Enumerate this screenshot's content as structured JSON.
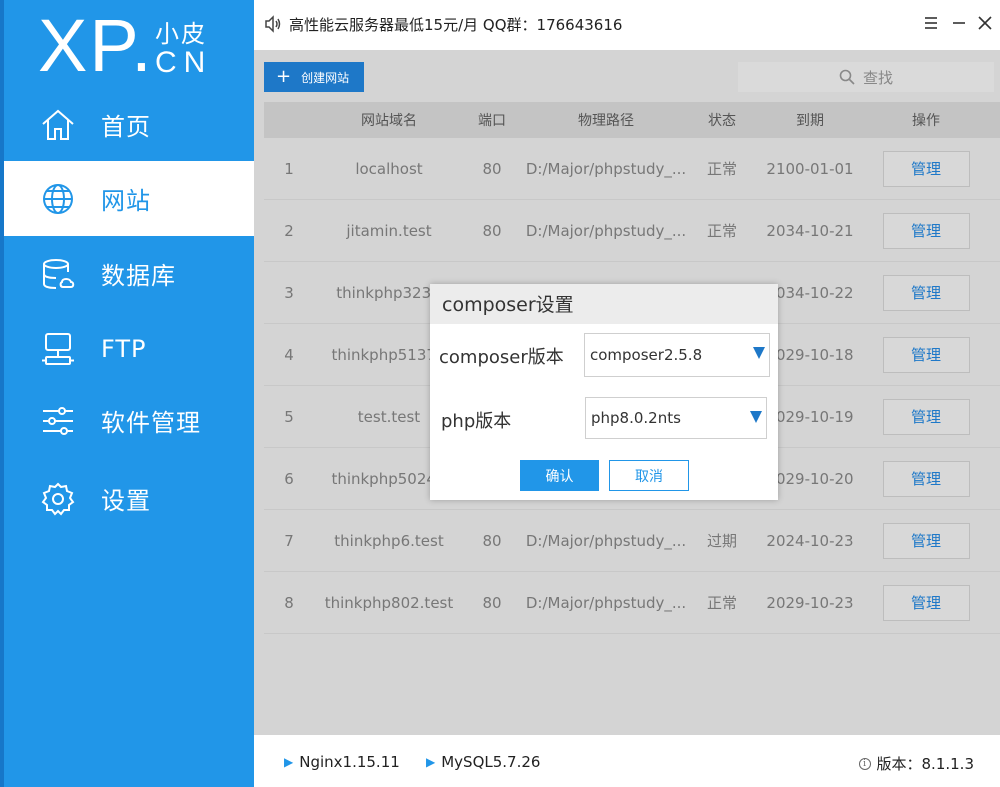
{
  "app": {
    "logo_main": "XP.",
    "logo_cn_chars": "小皮",
    "logo_cn": "CN"
  },
  "topbar": {
    "notice": "高性能云服务器最低15元/月  QQ群：176643616",
    "menu_icon": "hamburger-icon",
    "minimize_icon": "minimize-icon",
    "close_icon": "close-icon"
  },
  "sidebar": {
    "items": [
      {
        "label": "首页",
        "icon": "home-icon"
      },
      {
        "label": "网站",
        "icon": "globe-icon"
      },
      {
        "label": "数据库",
        "icon": "database-icon"
      },
      {
        "label": "FTP",
        "icon": "ftp-icon"
      },
      {
        "label": "软件管理",
        "icon": "sliders-icon"
      },
      {
        "label": "设置",
        "icon": "gear-icon"
      }
    ],
    "active_index": 1
  },
  "toolbar": {
    "create_label": "创建网站",
    "search_label": "查找"
  },
  "table": {
    "headers": {
      "domain": "网站域名",
      "port": "端口",
      "path": "物理路径",
      "status": "状态",
      "expire": "到期",
      "action": "操作"
    },
    "rows": [
      {
        "no": "1",
        "domain": "localhost",
        "port": "80",
        "path": "D:/Major/phpstudy_...",
        "status": "正常",
        "expire": "2100-01-01",
        "action": "管理"
      },
      {
        "no": "2",
        "domain": "jitamin.test",
        "port": "80",
        "path": "D:/Major/phpstudy_...",
        "status": "正常",
        "expire": "2034-10-21",
        "action": "管理"
      },
      {
        "no": "3",
        "domain": "thinkphp323.t",
        "port": "",
        "path": "",
        "status": "",
        "expire": "2034-10-22",
        "action": "管理"
      },
      {
        "no": "4",
        "domain": "thinkphp5137.t",
        "port": "",
        "path": "",
        "status": "",
        "expire": "2029-10-18",
        "action": "管理"
      },
      {
        "no": "5",
        "domain": "test.test",
        "port": "",
        "path": "",
        "status": "",
        "expire": "2029-10-19",
        "action": "管理"
      },
      {
        "no": "6",
        "domain": "thinkphp5024.t",
        "port": "",
        "path": "",
        "status": "",
        "expire": "2029-10-20",
        "action": "管理"
      },
      {
        "no": "7",
        "domain": "thinkphp6.test",
        "port": "80",
        "path": "D:/Major/phpstudy_...",
        "status": "过期",
        "expire": "2024-10-23",
        "action": "管理"
      },
      {
        "no": "8",
        "domain": "thinkphp802.test",
        "port": "80",
        "path": "D:/Major/phpstudy_...",
        "status": "正常",
        "expire": "2029-10-23",
        "action": "管理"
      }
    ]
  },
  "statusbar": {
    "nginx": "Nginx1.15.11",
    "mysql": "MySQL5.7.26",
    "version": "版本：8.1.1.3"
  },
  "dialog": {
    "title": "composer设置",
    "composer_label": "composer版本",
    "composer_value": "composer2.5.8",
    "php_label": "php版本",
    "php_value": "php8.0.2nts",
    "ok_label": "确认",
    "cancel_label": "取消"
  },
  "colors": {
    "brand": "#2196e8",
    "accent_dark": "#1e78c8"
  }
}
